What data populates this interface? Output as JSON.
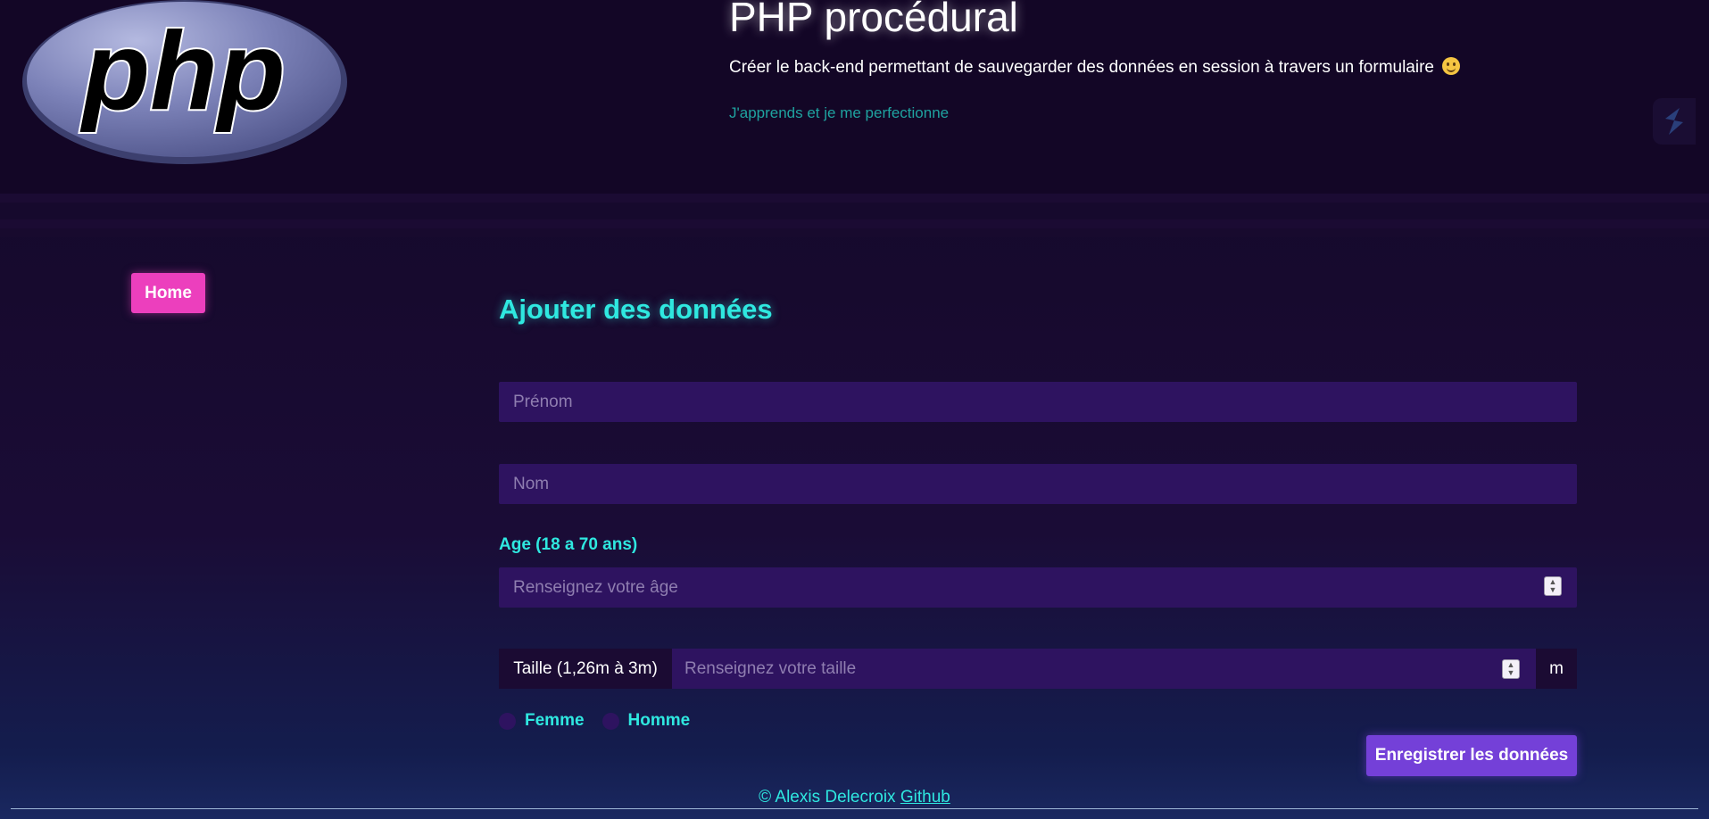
{
  "header": {
    "logo_text": "php",
    "title": "PHP procédural",
    "subtitle": "Créer le back-end permettant de sauvegarder des données en session à travers un formulaire",
    "subtitle_emoji_icon": "smiling-face-icon",
    "tagline": "J'apprends et je me perfectionne"
  },
  "nav": {
    "home_label": "Home"
  },
  "form": {
    "title": "Ajouter des données",
    "first_name_placeholder": "Prénom",
    "last_name_placeholder": "Nom",
    "age_label": "Age (18 a 70 ans)",
    "age_placeholder": "Renseignez votre âge",
    "height_label": "Taille (1,26m à 3m)",
    "height_placeholder": "Renseignez votre taille",
    "height_unit": "m",
    "gender_options": [
      "Femme",
      "Homme"
    ],
    "submit_label": "Enregistrer les données"
  },
  "footer": {
    "copyright": "© Alexis Delecroix",
    "link_label": "Github"
  },
  "colors": {
    "accent_cyan": "#2fe8e0",
    "home_pink": "#ec3fbd",
    "submit_purple": "#7440d8",
    "input_bg": "#2e1360"
  }
}
